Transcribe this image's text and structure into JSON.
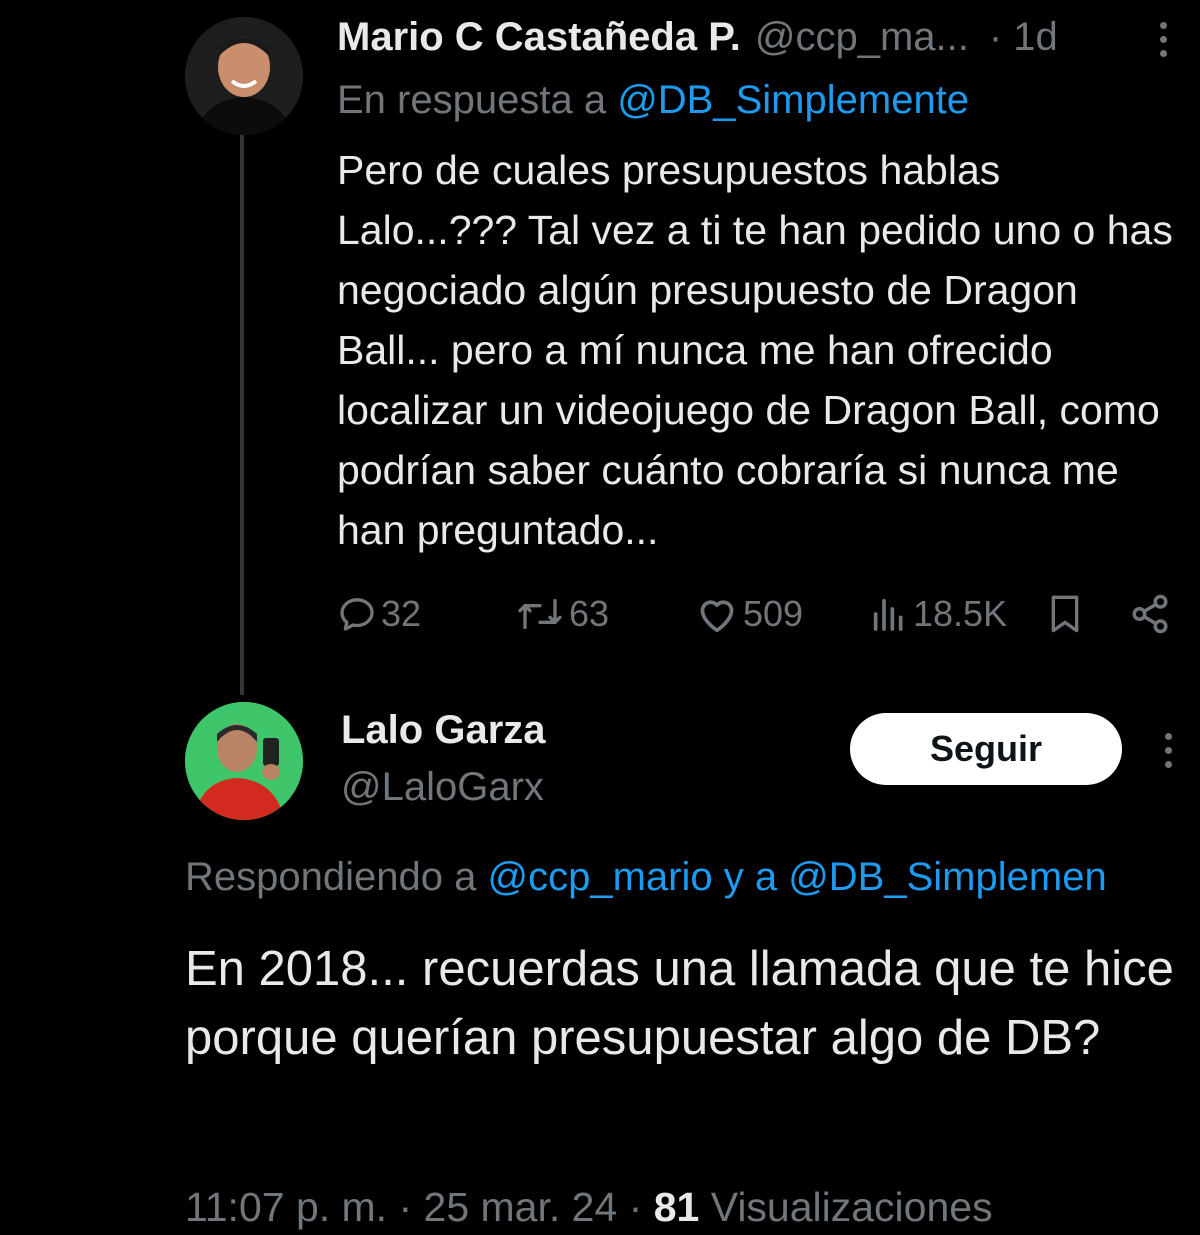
{
  "tweet1": {
    "name": "Mario C Castañeda P.",
    "handle": "@ccp_ma...",
    "time": "· 1d",
    "reply_prefix": "En respuesta a",
    "reply_mention": "@DB_Simplemente",
    "body": "Pero de cuales presupuestos hablas Lalo...??? Tal vez a ti te han pedido uno o has negociado algún presupuesto de Dragon Ball... pero a mí nunca me han ofrecido localizar un videojuego de Dragon Ball, como podrían saber cuánto cobraría si nunca me han preguntado...",
    "stats": {
      "replies": "32",
      "retweets": "63",
      "likes": "509",
      "views": "18.5K"
    },
    "icons": [
      "reply-icon",
      "retweet-icon",
      "like-icon",
      "views-icon",
      "bookmark-icon",
      "share-icon",
      "more-icon"
    ]
  },
  "tweet2": {
    "name": "Lalo Garza",
    "handle": "@LaloGarx",
    "follow_label": "Seguir",
    "replying_prefix": "Respondiendo a",
    "replying_mentions": "@ccp_mario y a @DB_Simplemen",
    "body": "En 2018... recuerdas una llamada que te hice porque querían presupuestar algo de DB?",
    "timestamp": "11:07 p. m. · 25 mar. 24 ·",
    "views_count": "81",
    "views_label": "Visualizaciones"
  },
  "colors": {
    "background": "#000000",
    "text": "#e7e9ea",
    "secondary": "#71767b",
    "link": "#1d9bf0",
    "avatar2_bg": "#3fc66a"
  }
}
